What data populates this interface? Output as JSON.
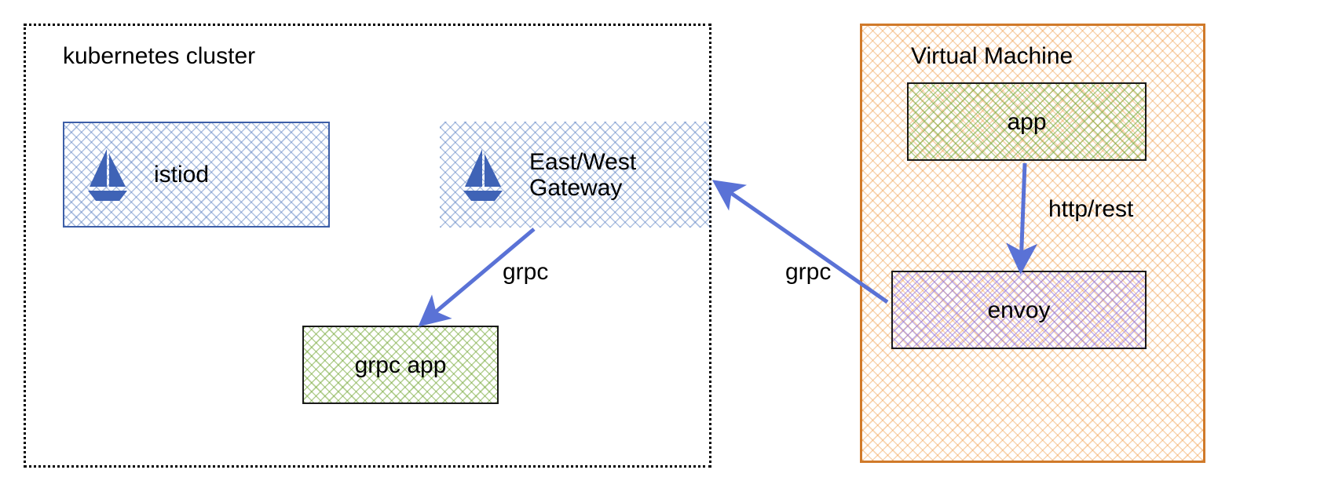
{
  "containers": {
    "k8s": {
      "label": "kubernetes cluster"
    },
    "vm": {
      "label": "Virtual Machine"
    }
  },
  "nodes": {
    "istiod": {
      "label": "istiod"
    },
    "ewgw": {
      "line1": "East/West",
      "line2": "Gateway"
    },
    "grpc_app": {
      "label": "grpc app"
    },
    "app": {
      "label": "app"
    },
    "envoy": {
      "label": "envoy"
    }
  },
  "edges": {
    "ewgw_to_grpcapp": {
      "label": "grpc"
    },
    "envoy_to_ewgw": {
      "label": "grpc"
    },
    "app_to_envoy": {
      "label": "http/rest"
    }
  },
  "icons": {
    "istio_sail": "istio-sail-icon"
  },
  "colors": {
    "arrow": "#5a72d6",
    "blue_hatch": "#4f73b8",
    "green_hatch": "#8bbf4a",
    "purple_hatch": "#9d85e0",
    "orange_hatch": "#e8913a"
  }
}
